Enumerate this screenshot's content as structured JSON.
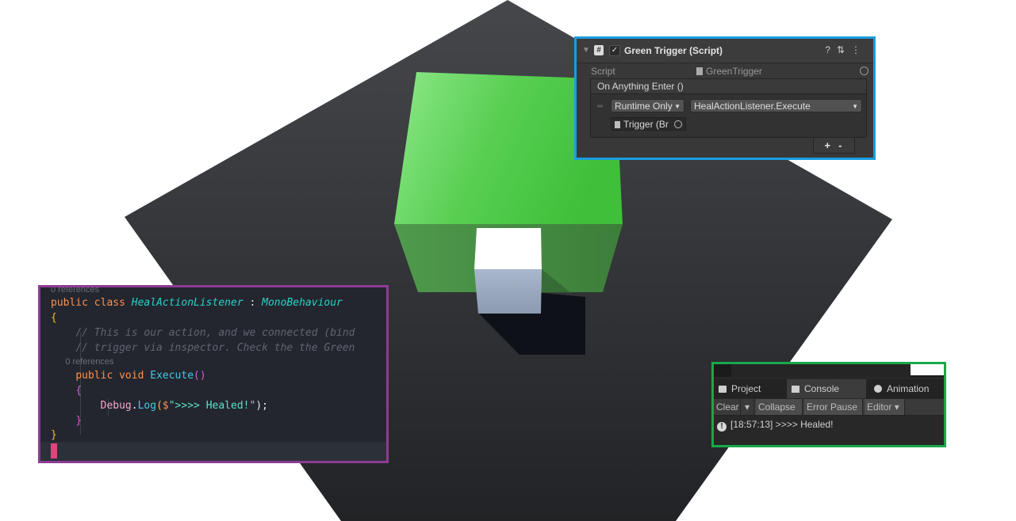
{
  "inspector": {
    "component_title": "Green Trigger (Script)",
    "enabled_check": "✓",
    "hash_glyph": "#",
    "script_label": "Script",
    "script_value": "GreenTrigger",
    "event_header": "On Anything Enter ()",
    "runtime_option": "Runtime Only",
    "function_value": "HealActionListener.Execute",
    "object_field": "Trigger (Br",
    "add_button": "+",
    "remove_button": "-",
    "icons": [
      "question-icon",
      "sliders-icon",
      "kebab-menu-icon"
    ]
  },
  "code": {
    "ref_top": "0 references",
    "kw_public": "public",
    "kw_class": "class",
    "class_name": "HealActionListener",
    "colon": ":",
    "base_class": "MonoBehaviour",
    "open_brace": "{",
    "comment1": "// This is our action, and we connected (bind",
    "comment2": "// trigger via inspector. Check the the Green",
    "ref_method": "0 references",
    "kw_void": "void",
    "method_name": "Execute",
    "parens": "()",
    "inner_open": "{",
    "debug": "Debug",
    "dot": ".",
    "log": "Log",
    "lparen": "(",
    "dollar": "$",
    "string": "\">>>> Healed!\"",
    "rparen_semi": ");",
    "inner_close": "}",
    "close_brace": "}"
  },
  "console": {
    "tabs": [
      "Project",
      "Console",
      "Animation"
    ],
    "active_tab": "Console",
    "toolbar": {
      "clear": "Clear",
      "dropdown_arrow": "▾",
      "collapse": "Collapse",
      "error_pause": "Error Pause",
      "editor": "Editor"
    },
    "log_entry": "[18:57:13] >>>> Healed!",
    "info_glyph": "!"
  },
  "colors": {
    "inspector_border": "#1a9de0",
    "code_border": "#8e3b95",
    "console_border": "#18a84a",
    "green_cube": "#4cc747",
    "floor": "#2e3034"
  }
}
